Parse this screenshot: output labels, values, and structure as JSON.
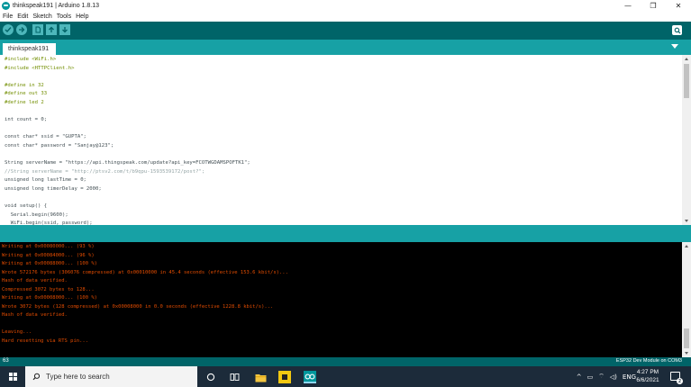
{
  "window": {
    "title": "thinkspeak191 | Arduino 1.8.13",
    "controls": {
      "minimize": "—",
      "maximize": "❐",
      "close": "✕"
    }
  },
  "menu": {
    "items": [
      "File",
      "Edit",
      "Sketch",
      "Tools",
      "Help"
    ]
  },
  "toolbar": {
    "verify_icon": "check-icon",
    "upload_icon": "arrow-right-icon",
    "new_icon": "new-file-icon",
    "open_icon": "arrow-up-icon",
    "save_icon": "arrow-down-icon",
    "serial_monitor_icon": "magnifier-icon"
  },
  "tabs": [
    {
      "label": "thinkspeak191"
    }
  ],
  "editor": {
    "lines": [
      "#include <WiFi.h>",
      "#include <HTTPClient.h>",
      "",
      "#define in 32",
      "#define out 33",
      "#define led 2",
      "",
      "int count = 0;",
      "",
      "const char* ssid = \"GUPTA\";",
      "const char* password = \"Sanjay@123\";",
      "",
      "String serverName = \"https://api.thingspeak.com/update?api_key=FCOTWGDAMSPOFTK1\";",
      "//String serverName = \"http://ptsv2.com/t/b9qpu-1593539172/post?\";",
      "unsigned long lastTime = 0;",
      "unsigned long timerDelay = 2000;",
      "",
      "void setup() {",
      "  Serial.begin(9600);",
      "  WiFi.begin(ssid, password);"
    ]
  },
  "console": {
    "lines": [
      "Writing at 0x00080000... (93 %)",
      "Writing at 0x00084000... (96 %)",
      "Writing at 0x00088000... (100 %)",
      "Wrote 572176 bytes (306076 compressed) at 0x00010000 in 45.4 seconds (effective 153.6 kbit/s)...",
      "Hash of data verified.",
      "Compressed 3072 bytes to 128...",
      "Writing at 0x00008000... (100 %)",
      "Wrote 3072 bytes (128 compressed) at 0x00008000 in 0.0 seconds (effective 1228.8 kbit/s)...",
      "Hash of data verified.",
      "",
      "Leaving...",
      "Hard resetting via RTS pin..."
    ]
  },
  "status": {
    "line_number": "63",
    "board": "ESP32 Dev Module on COM3"
  },
  "taskbar": {
    "search_placeholder": "Type here to search",
    "language": "ENG",
    "time": "4:27 PM",
    "date": "6/6/2021",
    "notification_count": "2"
  },
  "colors": {
    "toolbar": "#006468",
    "tabstrip": "#17a1a5",
    "console_text": "#e34c00",
    "taskbar": "#1c2b3a"
  }
}
